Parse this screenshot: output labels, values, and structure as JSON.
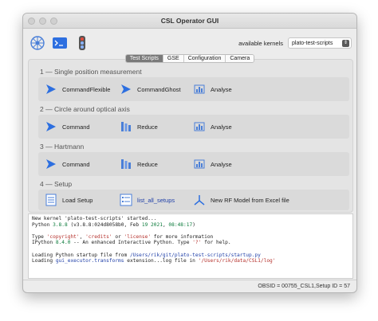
{
  "window": {
    "title": "CSL Operator GUI"
  },
  "toolbar": {
    "kernel_label": "available kernels",
    "kernel_value": "plato-test-scripts",
    "icons": [
      "settings-wheel-icon",
      "terminal-icon",
      "traffic-light-icon"
    ]
  },
  "tabs": [
    {
      "label": "Test Scripts",
      "active": true
    },
    {
      "label": "GSE",
      "active": false
    },
    {
      "label": "Configuration",
      "active": false
    },
    {
      "label": "Camera",
      "active": false
    }
  ],
  "sections": [
    {
      "title": "1 — Single position measurement",
      "actions": [
        "CommandFlexible",
        "CommandGhost",
        "Analyse"
      ]
    },
    {
      "title": "2 — Circle around optical axis",
      "actions": [
        "Command",
        "Reduce",
        "Analyse"
      ]
    },
    {
      "title": "3 — Hartmann",
      "actions": [
        "Command",
        "Reduce",
        "Analyse"
      ]
    },
    {
      "title": "4 — Setup",
      "actions": [
        "Load Setup",
        "list_all_setups",
        "New RF Model from Excel file"
      ]
    }
  ],
  "console": {
    "l1": "New kernel 'plato-test-scripts' started...",
    "l2a": "Python ",
    "l2b": "3.8.8",
    "l2c": " (v3.8.8:024d8058b0, Feb ",
    "l2d": "19",
    "l2e": " ",
    "l2f": "2021",
    "l2g": ", ",
    "l2h": "08:48:17",
    "l2i": ")",
    "l3a": "Type ",
    "l3b": "'copyright'",
    "l3c": ", ",
    "l3d": "'credits'",
    "l3e": " or ",
    "l3f": "'license'",
    "l3g": " for more information",
    "l4a": "IPython ",
    "l4b": "8.4.0",
    "l4c": " -- An enhanced Interactive Python. Type ",
    "l4d": "'?'",
    "l4e": " for help.",
    "l5a": "Loading Python startup file from ",
    "l5b": "/Users/rik/git/plato-test-scripts/startup.py",
    "l6a": "Loading ",
    "l6b": "gui_executor.transforms",
    "l6c": " extension...log file in ",
    "l6d": "'/Users/rik/data/CSL1/log'"
  },
  "status": {
    "text": "OBSID = 00755_CSL1,Setup ID = 57"
  },
  "colors": {
    "accent": "#1f5fd6",
    "link": "#1f3fa8"
  }
}
